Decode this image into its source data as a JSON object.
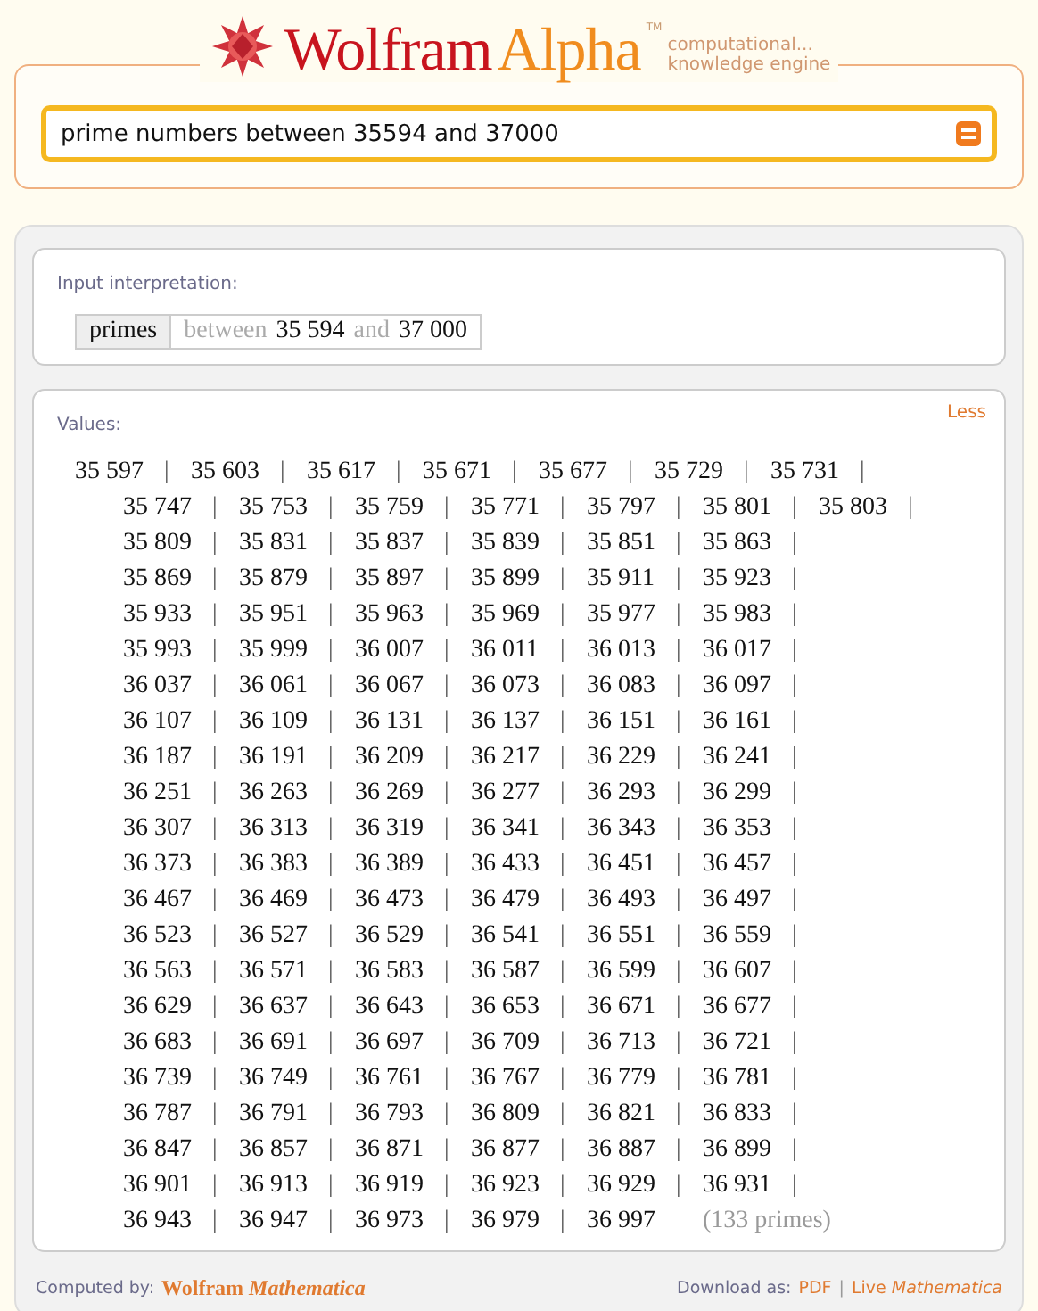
{
  "logo": {
    "word_1": "Wolfram",
    "word_2": "Alpha",
    "trademark": "TM",
    "tagline_1": "computational...",
    "tagline_2": "knowledge engine"
  },
  "search": {
    "value": "prime numbers between 35594 and 37000"
  },
  "interpretation": {
    "title": "Input interpretation:",
    "head": "primes",
    "parts": [
      {
        "text": "between",
        "kind": "keyword"
      },
      {
        "text": "35 594",
        "kind": "number"
      },
      {
        "text": "and",
        "kind": "keyword"
      },
      {
        "text": "37 000",
        "kind": "number"
      }
    ]
  },
  "values": {
    "title": "Values:",
    "toggle": "Less",
    "separator": "|",
    "count": "(133 primes)",
    "rows": [
      [
        "35 597",
        "35 603",
        "35 617",
        "35 671",
        "35 677",
        "35 729",
        "35 731"
      ],
      [
        "35 747",
        "35 753",
        "35 759",
        "35 771",
        "35 797",
        "35 801",
        "35 803"
      ],
      [
        "35 809",
        "35 831",
        "35 837",
        "35 839",
        "35 851",
        "35 863"
      ],
      [
        "35 869",
        "35 879",
        "35 897",
        "35 899",
        "35 911",
        "35 923"
      ],
      [
        "35 933",
        "35 951",
        "35 963",
        "35 969",
        "35 977",
        "35 983"
      ],
      [
        "35 993",
        "35 999",
        "36 007",
        "36 011",
        "36 013",
        "36 017"
      ],
      [
        "36 037",
        "36 061",
        "36 067",
        "36 073",
        "36 083",
        "36 097"
      ],
      [
        "36 107",
        "36 109",
        "36 131",
        "36 137",
        "36 151",
        "36 161"
      ],
      [
        "36 187",
        "36 191",
        "36 209",
        "36 217",
        "36 229",
        "36 241"
      ],
      [
        "36 251",
        "36 263",
        "36 269",
        "36 277",
        "36 293",
        "36 299"
      ],
      [
        "36 307",
        "36 313",
        "36 319",
        "36 341",
        "36 343",
        "36 353"
      ],
      [
        "36 373",
        "36 383",
        "36 389",
        "36 433",
        "36 451",
        "36 457"
      ],
      [
        "36 467",
        "36 469",
        "36 473",
        "36 479",
        "36 493",
        "36 497"
      ],
      [
        "36 523",
        "36 527",
        "36 529",
        "36 541",
        "36 551",
        "36 559"
      ],
      [
        "36 563",
        "36 571",
        "36 583",
        "36 587",
        "36 599",
        "36 607"
      ],
      [
        "36 629",
        "36 637",
        "36 643",
        "36 653",
        "36 671",
        "36 677"
      ],
      [
        "36 683",
        "36 691",
        "36 697",
        "36 709",
        "36 713",
        "36 721"
      ],
      [
        "36 739",
        "36 749",
        "36 761",
        "36 767",
        "36 779",
        "36 781"
      ],
      [
        "36 787",
        "36 791",
        "36 793",
        "36 809",
        "36 821",
        "36 833"
      ],
      [
        "36 847",
        "36 857",
        "36 871",
        "36 877",
        "36 887",
        "36 899"
      ],
      [
        "36 901",
        "36 913",
        "36 919",
        "36 923",
        "36 929",
        "36 931"
      ],
      [
        "36 943",
        "36 947",
        "36 973",
        "36 979",
        "36 997"
      ]
    ]
  },
  "footer": {
    "computed_label": "Computed by:",
    "computed_brand": "Wolfram *Mathematica*",
    "download_label": "Download as:",
    "links": [
      "PDF",
      "Live *Mathematica*"
    ],
    "link_separator": "|"
  }
}
